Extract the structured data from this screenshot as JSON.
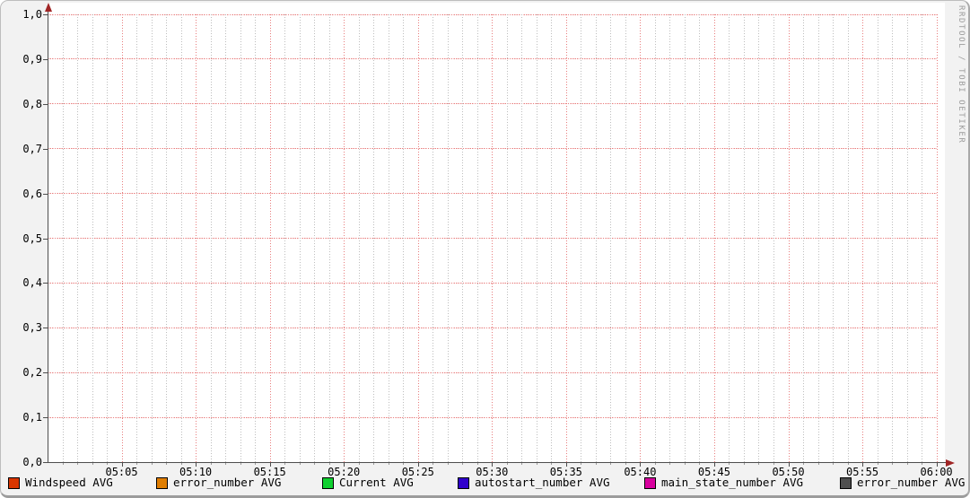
{
  "watermark": "RRDTOOL / TOBI OETIKER",
  "colors": {
    "background": "#F2F2F2",
    "canvas": "#FFFFFF",
    "major_grid": "#E87D7D",
    "minor_grid": "#BDBDBD",
    "axis": "#4E4E4E",
    "arrow": "#A02525",
    "watermark": "#9C9C9C"
  },
  "chart_data": {
    "type": "line",
    "title": "",
    "xlabel": "",
    "ylabel": "",
    "x_axis": {
      "start": "05:00",
      "end": "06:00",
      "tick_labels": [
        "05:05",
        "05:10",
        "05:15",
        "05:20",
        "05:25",
        "05:30",
        "05:35",
        "05:40",
        "05:45",
        "05:50",
        "05:55",
        "06:00"
      ],
      "major_step_minutes": 5,
      "minor_step_minutes": 1
    },
    "y_axis": {
      "min": 0.0,
      "max": 1.0,
      "step": 0.1,
      "tick_labels": [
        "0,0",
        "0,1",
        "0,2",
        "0,3",
        "0,4",
        "0,5",
        "0,6",
        "0,7",
        "0,8",
        "0,9",
        "1,0"
      ]
    },
    "grid": true,
    "legend_position": "bottom",
    "series": [
      {
        "name": "Windspeed AVG",
        "color": "#D93600",
        "values": []
      },
      {
        "name": "error_number AVG",
        "color": "#DF7D00",
        "values": []
      },
      {
        "name": "Current AVG",
        "color": "#10D030",
        "values": []
      },
      {
        "name": "autostart_number AVG",
        "color": "#3000CC",
        "values": []
      },
      {
        "name": "main_state_number AVG",
        "color": "#D8009E",
        "values": []
      },
      {
        "name": "error_number AVG",
        "color": "#4F4F4F",
        "values": []
      }
    ]
  }
}
